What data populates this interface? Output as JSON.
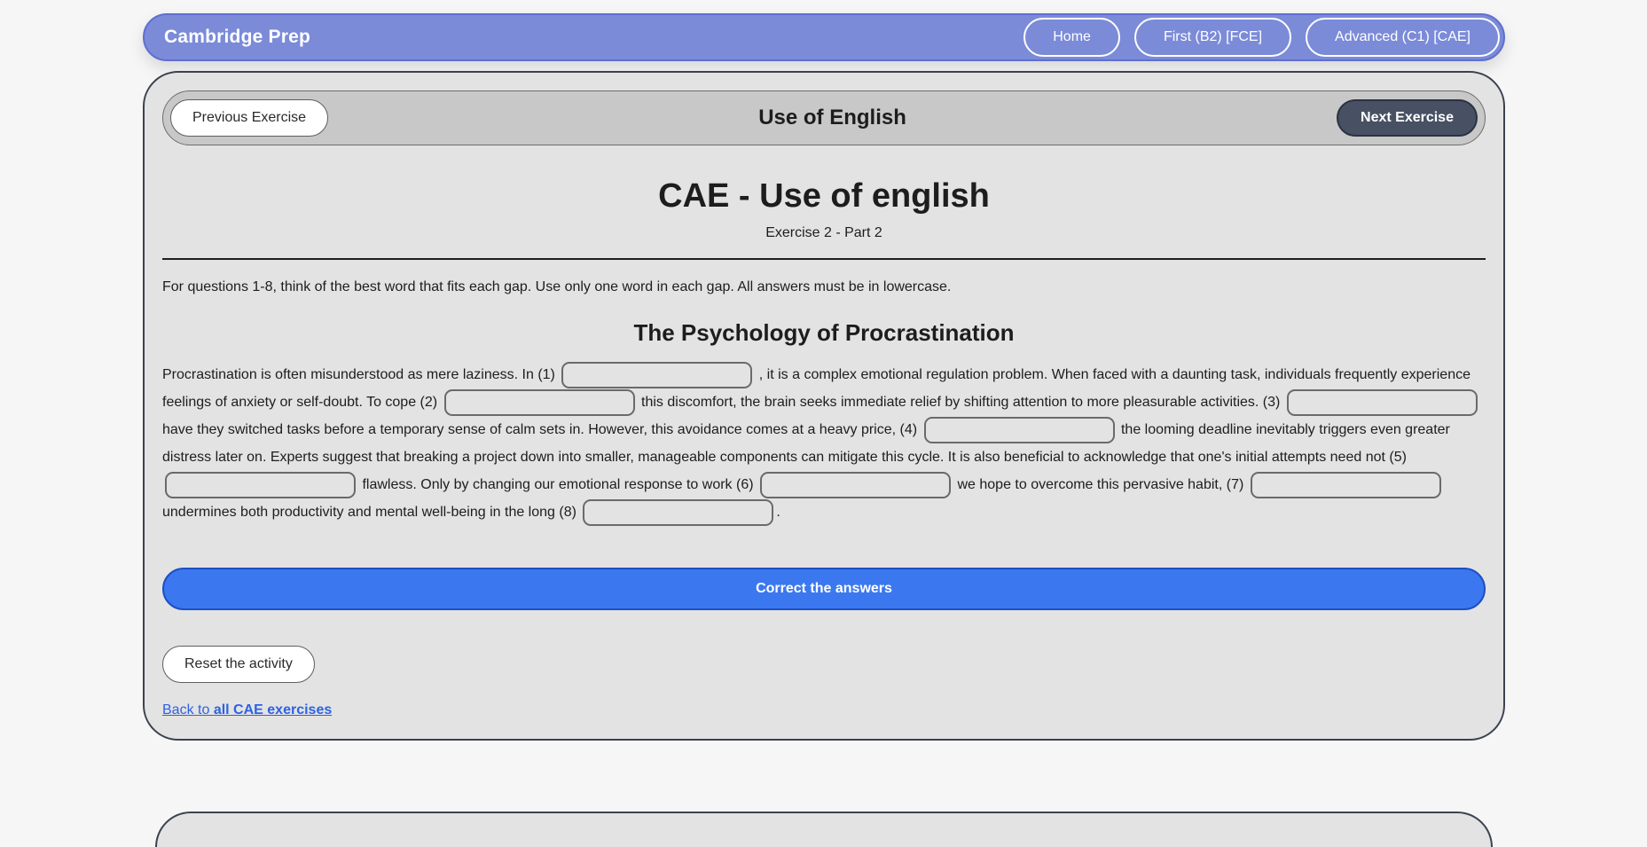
{
  "navbar": {
    "brand": "Cambridge Prep",
    "links": [
      {
        "label": "Home"
      },
      {
        "label": "First (B2) [FCE]"
      },
      {
        "label": "Advanced (C1) [CAE]"
      }
    ]
  },
  "exercise_bar": {
    "previous_label": "Previous Exercise",
    "title": "Use of English",
    "next_label": "Next Exercise"
  },
  "header": {
    "title": "CAE - Use of english",
    "subtitle": "Exercise 2 - Part 2"
  },
  "instructions": "For questions 1-8, think of the best word that fits each gap. Use only one word in each gap. All answers must be in lowercase.",
  "text_title": "The Psychology of Procrastination",
  "passage": {
    "seg0": "Procrastination is often misunderstood as mere laziness. In (1)",
    "gap1": "",
    "seg1": ", it is a complex emotional regulation problem. When faced with a daunting task, individuals frequently experience feelings of anxiety or self-doubt. To cope (2)",
    "gap2": "",
    "seg2": "this discomfort, the brain seeks immediate relief by shifting attention to more pleasurable activities. (3)",
    "gap3": "",
    "seg3": "have they switched tasks before a temporary sense of calm sets in. However, this avoidance comes at a heavy price, (4)",
    "gap4": "",
    "seg4": "the looming deadline inevitably triggers even greater distress later on. Experts suggest that breaking a project down into smaller, manageable components can mitigate this cycle. It is also beneficial to acknowledge that one's initial attempts need not (5)",
    "gap5": "",
    "seg5": "flawless. Only by changing our emotional response to work (6)",
    "gap6": "",
    "seg6": "we hope to overcome this pervasive habit, (7)",
    "gap7": "",
    "seg7": "undermines both productivity and mental well-being in the long (8)",
    "gap8": "",
    "seg8": "."
  },
  "actions": {
    "correct_label": "Correct the answers",
    "reset_label": "Reset the activity",
    "back_prefix": "Back to ",
    "back_bold": "all CAE exercises"
  },
  "colors": {
    "navbar": "#7b8bd8",
    "card": "#e3e3e3",
    "primary_button": "#3b78f0",
    "next_button": "#475163",
    "link": "#2d62e3"
  }
}
